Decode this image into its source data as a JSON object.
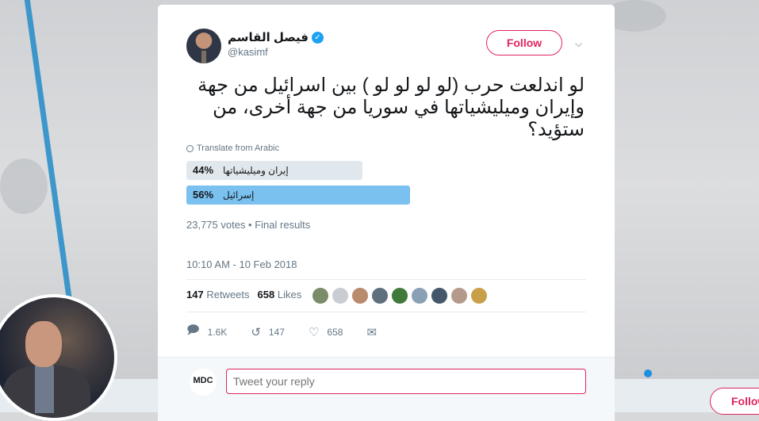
{
  "tweet": {
    "author_name": "فيصل القاسم",
    "handle": "@kasimf",
    "follow_label": "Follow",
    "text": "لو اندلعت حرب (لو لو لو لو ) بين اسرائيل من جهة وإيران وميليشياتها في سوريا من جهة أخرى، من ستؤيد؟",
    "translate_label": "Translate from Arabic",
    "poll": {
      "options": [
        {
          "label": "إيران وميليشياتها",
          "percent_text": "44%",
          "percent": 44
        },
        {
          "label": "إسرائيل",
          "percent_text": "56%",
          "percent": 56
        }
      ],
      "votes_summary": "23,775 votes • Final results"
    },
    "timestamp": "10:10 AM - 10 Feb 2018",
    "stats": {
      "retweets_count": "147",
      "retweets_label": "Retweets",
      "likes_count": "658",
      "likes_label": "Likes"
    },
    "likers_colors": [
      "#7b8c6a",
      "#c9cdd2",
      "#b98a6c",
      "#5e6f7e",
      "#3f7a3a",
      "#8aa1b5",
      "#45576b",
      "#b59a8c",
      "#c9a04a"
    ],
    "actions": {
      "reply_count": "1.6K",
      "retweet_count": "147",
      "like_count": "658"
    },
    "icons": {
      "reply": "reply-icon",
      "retweet": "retweet-icon",
      "like": "heart-icon",
      "dm": "mail-icon"
    }
  },
  "reply_box": {
    "avatar_text": "MDC",
    "placeholder": "Tweet your reply"
  },
  "background": {
    "follow_label": "Follow"
  },
  "colors": {
    "accent": "#e0245e",
    "verified": "#1da1f2",
    "poll_winner": "#7ac1f0",
    "poll_other": "#e1e8ed"
  }
}
